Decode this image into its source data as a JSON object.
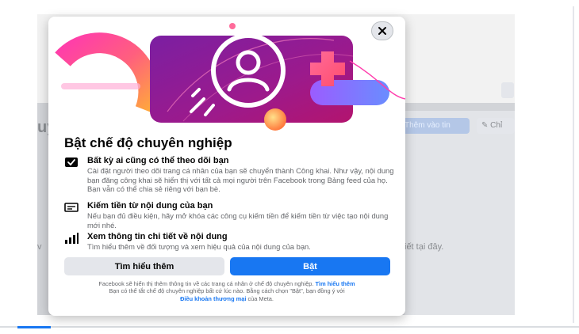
{
  "background": {
    "partial_name": "uy",
    "add_story_label": "Thêm vào tin",
    "edit_label": "Chỉ",
    "snippet_right": "iết tại đây.",
    "snippet_left": "v"
  },
  "modal": {
    "title": "Bật chế độ chuyên nghiệp",
    "items": [
      {
        "icon": "check-feed-icon",
        "title": "Bất kỳ ai cũng có thể theo dõi bạn",
        "description": "Cài đặt người theo dõi trang cá nhân của bạn sẽ chuyển thành Công khai. Như vậy, nội dung bạn đăng công khai sẽ hiển thị với tất cả mọi người trên Facebook trong Bảng feed của họ. Bạn vẫn có thể chia sẻ riêng với bạn bè."
      },
      {
        "icon": "money-icon",
        "title": "Kiếm tiền từ nội dung của bạn",
        "description": "Nếu bạn đủ điều kiện, hãy mở khóa các công cụ kiếm tiền để kiếm tiền từ việc tạo nội dung mới nhé."
      },
      {
        "icon": "bar-chart-icon",
        "title": "Xem thông tin chi tiết về nội dung",
        "description": "Tìm hiểu thêm về đối tượng và xem hiệu quả của nội dung của bạn."
      }
    ],
    "learn_more_label": "Tìm hiểu thêm",
    "turn_on_label": "Bật",
    "footer_text_1": "Facebook sẽ hiển thị thêm thông tin về các trang cá nhân ở chế độ chuyên nghiệp.",
    "footer_link_1": "Tìm hiểu thêm",
    "footer_text_2": "Bạn có thể tắt chế độ chuyên nghiệp bất cứ lúc nào. Bằng cách chọn \"Bật\", bạn đồng ý với",
    "footer_link_2": "Điều khoản thương mại",
    "footer_text_3": "của Meta."
  }
}
